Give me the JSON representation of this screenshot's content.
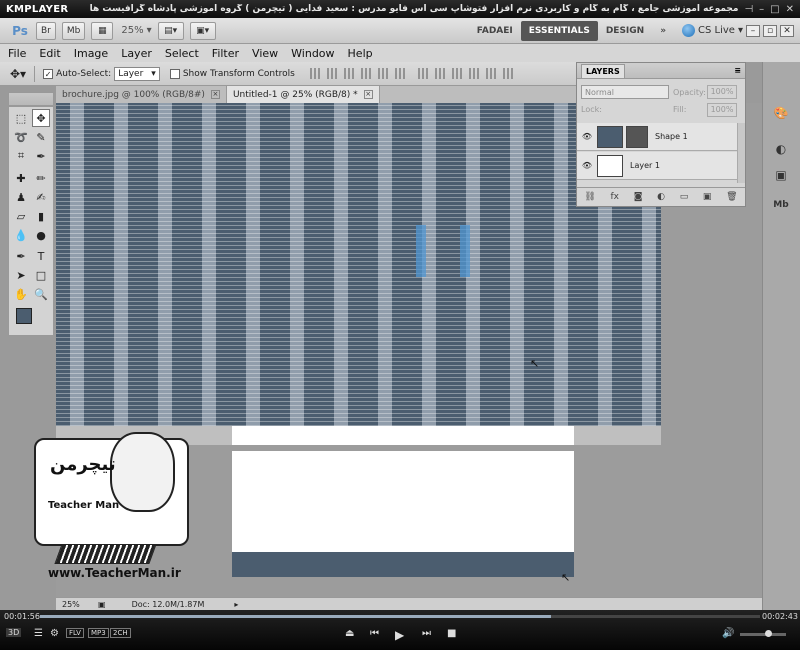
{
  "player": {
    "logo": "KMPLAYER",
    "title": "مجموعه آموزشی جامع ، گام به گام و کاربردی نرم افزار فتوشاپ سی اس فایو  مدرس : سعید فدایی ( تیچرمن ) گروه آموزشی پادشاه گرافیست ها",
    "time_elapsed": "00:01:56",
    "time_total": "00:02:43",
    "progress_fraction": 0.71,
    "badges": [
      "FLV",
      "MP3",
      "2CH"
    ],
    "volume_fraction": 0.55,
    "mode_3d": "3D"
  },
  "appbar": {
    "logo": "Ps",
    "bridge": "Br",
    "minibridge": "Mb",
    "zoom": "25%",
    "workspaces": [
      "FADAEI",
      "ESSENTIALS",
      "DESIGN"
    ],
    "active_workspace": "ESSENTIALS",
    "cslive": "CS Live"
  },
  "menu": [
    "File",
    "Edit",
    "Image",
    "Layer",
    "Select",
    "Filter",
    "View",
    "Window",
    "Help"
  ],
  "options": {
    "auto_select_label": "Auto-Select:",
    "auto_select_checked": true,
    "auto_select_value": "Layer",
    "show_transform_label": "Show Transform Controls"
  },
  "tabs": [
    {
      "label": "brochure.jpg @ 100% (RGB/8#)",
      "active": false
    },
    {
      "label": "Untitled-1 @ 25% (RGB/8) *",
      "active": true
    }
  ],
  "layers": {
    "title": "LAYERS",
    "blend_mode": "Normal",
    "opacity_label": "Opacity:",
    "opacity_value": "100%",
    "lock_label": "Lock:",
    "fill_label": "Fill:",
    "fill_value": "100%",
    "items": [
      {
        "name": "Shape 1",
        "color": "#4b5d6f"
      },
      {
        "name": "Layer 1",
        "color": "#ffffff"
      }
    ]
  },
  "status": {
    "zoom": "25%",
    "doc": "Doc: 12.0M/1.87M"
  },
  "watermark": {
    "name_fa": "تیچرمن",
    "name_en": "Teacher Man",
    "url": "www.TeacherMan.ir"
  },
  "colors": {
    "foreground": "#4b5d6f",
    "background": "#ffffff"
  }
}
